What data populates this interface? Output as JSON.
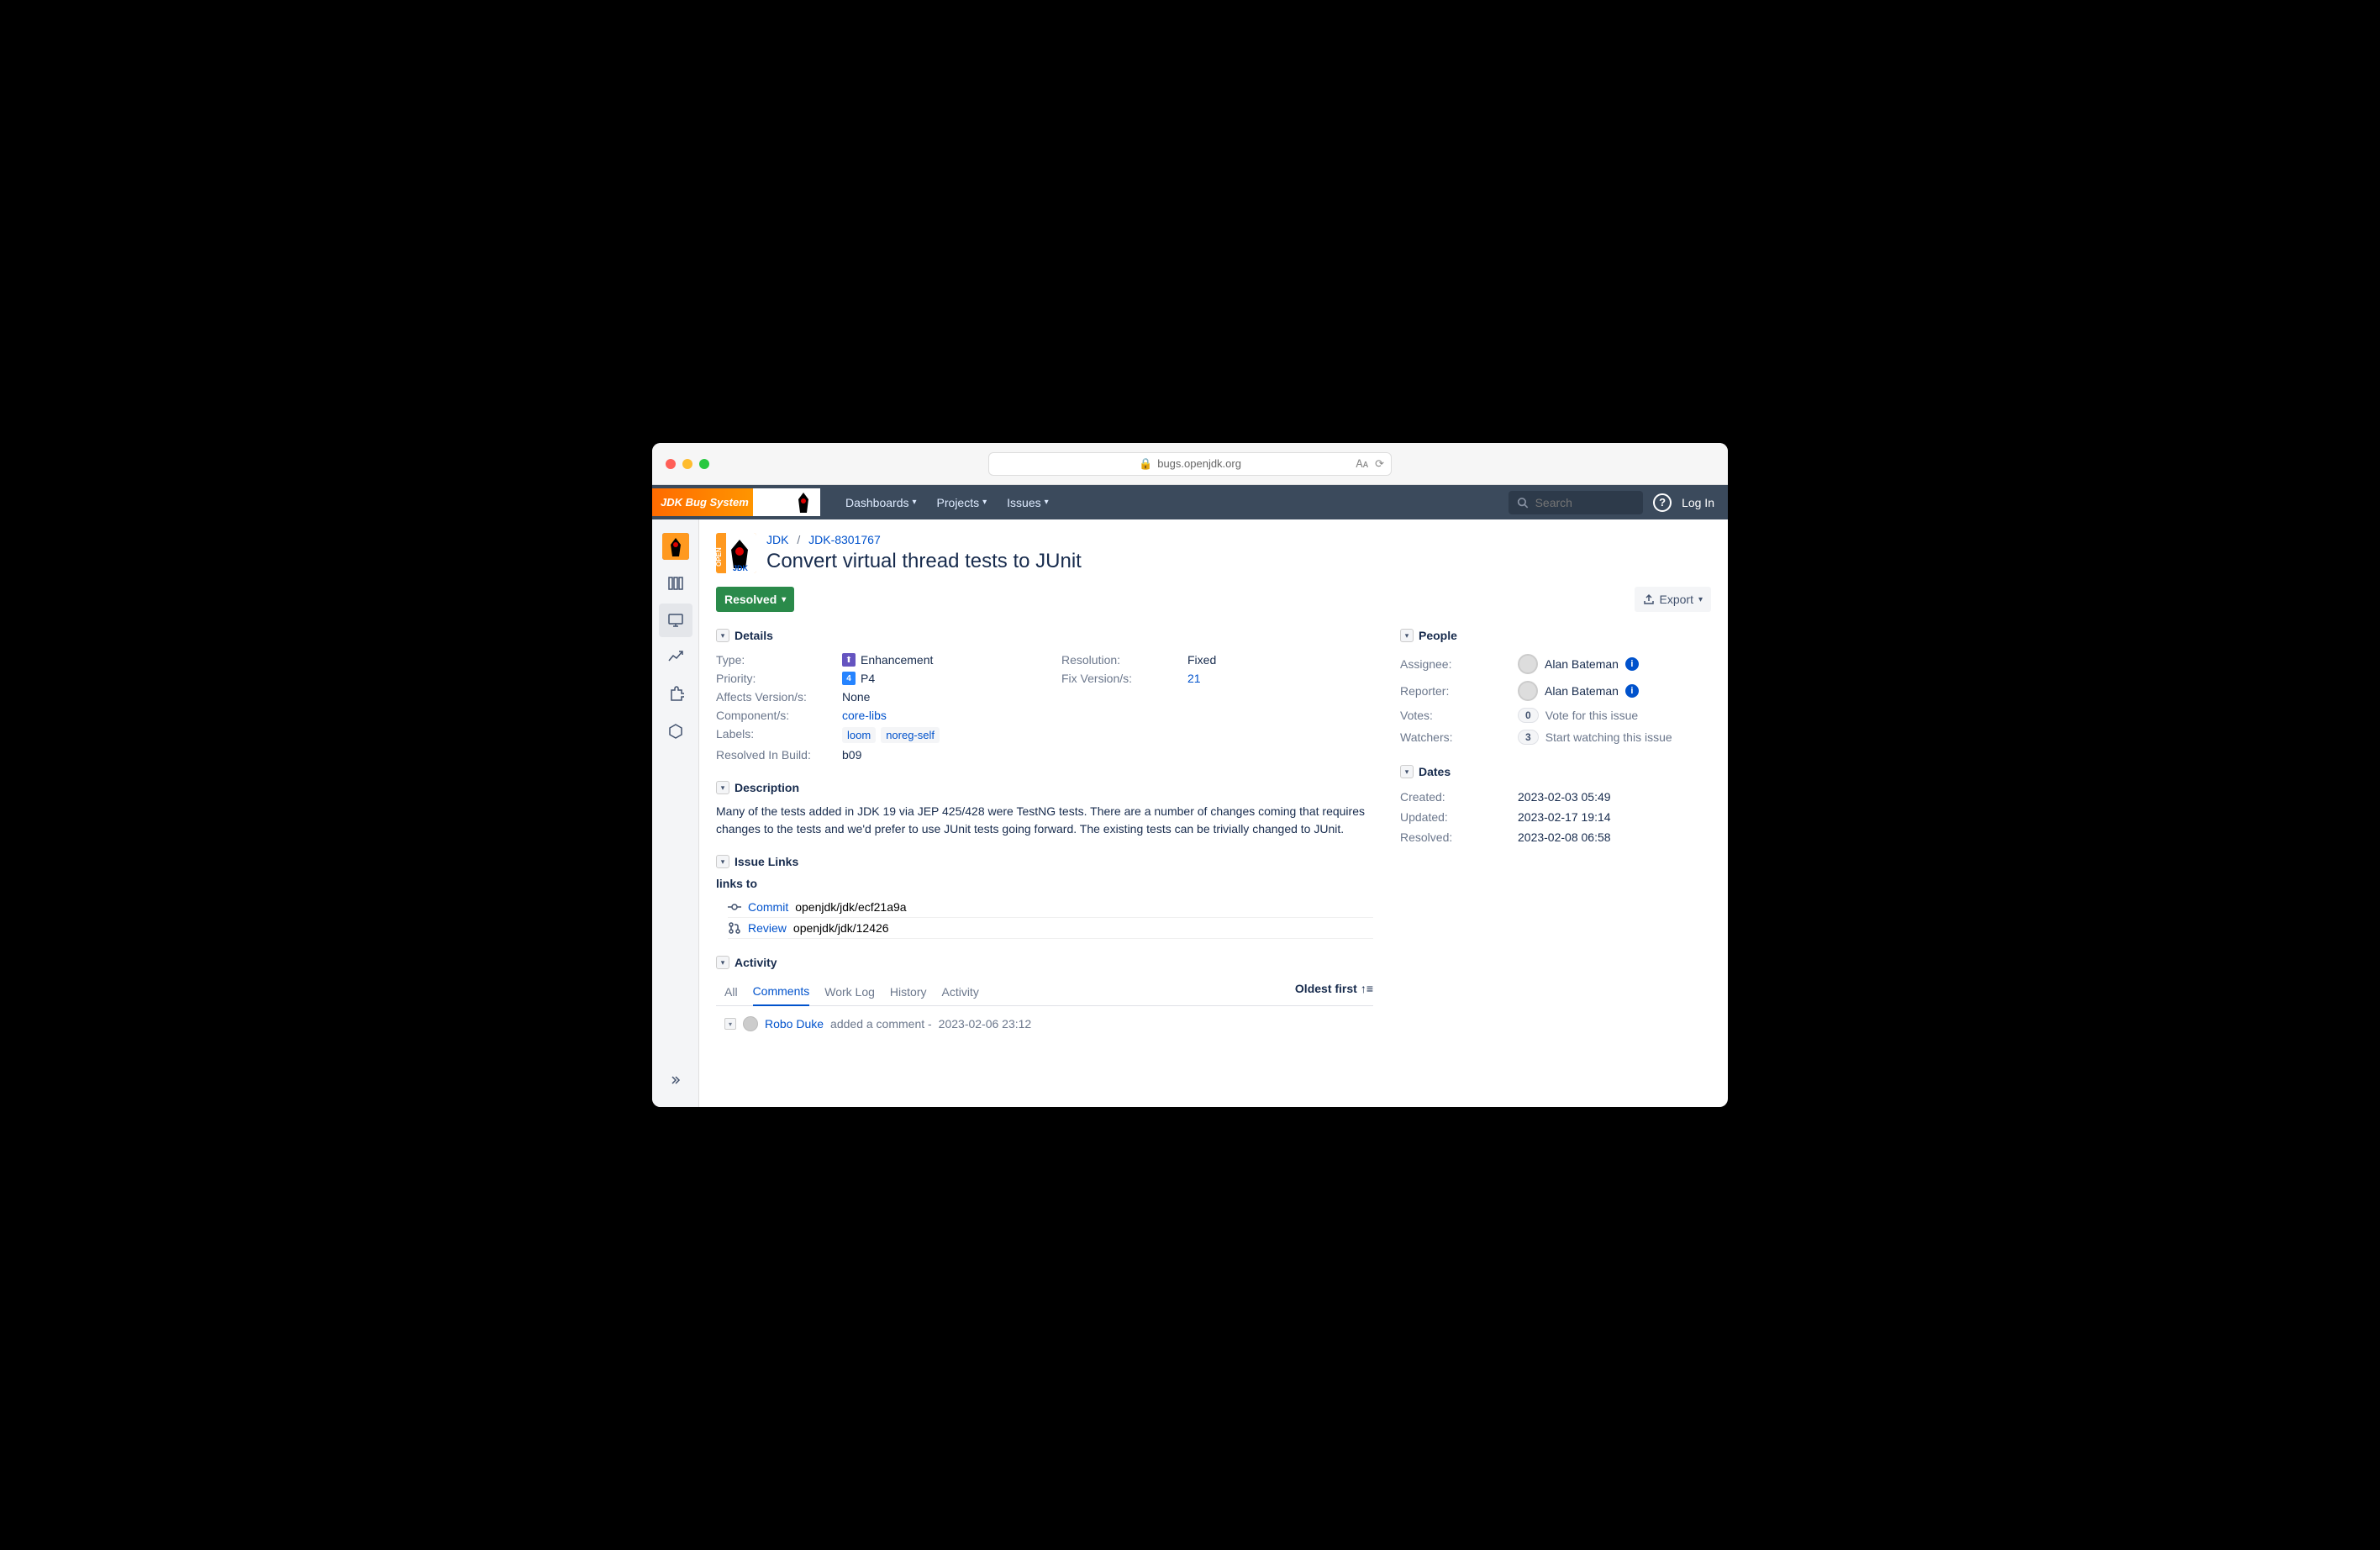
{
  "browser": {
    "url": "bugs.openjdk.org"
  },
  "nav": {
    "logo_text": "JDK Bug System",
    "dashboards": "Dashboards",
    "projects": "Projects",
    "issues": "Issues",
    "search_placeholder": "Search",
    "login": "Log In"
  },
  "breadcrumb": {
    "project": "JDK",
    "issue_key": "JDK-8301767"
  },
  "title": "Convert virtual thread tests to JUnit",
  "actions": {
    "status": "Resolved",
    "export": "Export"
  },
  "sections": {
    "details": "Details",
    "description": "Description",
    "issue_links": "Issue Links",
    "activity": "Activity",
    "people": "People",
    "dates": "Dates"
  },
  "details": {
    "type_label": "Type:",
    "type_value": "Enhancement",
    "priority_label": "Priority:",
    "priority_value": "P4",
    "affects_label": "Affects Version/s:",
    "affects_value": "None",
    "component_label": "Component/s:",
    "component_value": "core-libs",
    "labels_label": "Labels:",
    "labels": [
      "loom",
      "noreg-self"
    ],
    "resolved_build_label": "Resolved In Build:",
    "resolved_build_value": "b09",
    "resolution_label": "Resolution:",
    "resolution_value": "Fixed",
    "fix_version_label": "Fix Version/s:",
    "fix_version_value": "21"
  },
  "description_text": "Many of the tests added in JDK 19 via JEP 425/428 were TestNG tests. There are a number of changes coming that requires changes to the tests and we'd prefer to use JUnit tests going forward. The existing tests can be trivially changed to JUnit.",
  "links": {
    "header": "links to",
    "items": [
      {
        "type": "commit",
        "label": "Commit",
        "text": "openjdk/jdk/ecf21a9a"
      },
      {
        "type": "review",
        "label": "Review",
        "text": "openjdk/jdk/12426"
      }
    ]
  },
  "tabs": {
    "all": "All",
    "comments": "Comments",
    "worklog": "Work Log",
    "history": "History",
    "activity": "Activity",
    "sort": "Oldest first"
  },
  "comment": {
    "author": "Robo Duke",
    "action": "added a comment -",
    "date": "2023-02-06 23:12"
  },
  "people": {
    "assignee_label": "Assignee:",
    "assignee_value": "Alan Bateman",
    "reporter_label": "Reporter:",
    "reporter_value": "Alan Bateman",
    "votes_label": "Votes:",
    "votes_count": "0",
    "votes_action": "Vote for this issue",
    "watchers_label": "Watchers:",
    "watchers_count": "3",
    "watchers_action": "Start watching this issue"
  },
  "dates": {
    "created_label": "Created:",
    "created_value": "2023-02-03 05:49",
    "updated_label": "Updated:",
    "updated_value": "2023-02-17 19:14",
    "resolved_label": "Resolved:",
    "resolved_value": "2023-02-08 06:58"
  }
}
